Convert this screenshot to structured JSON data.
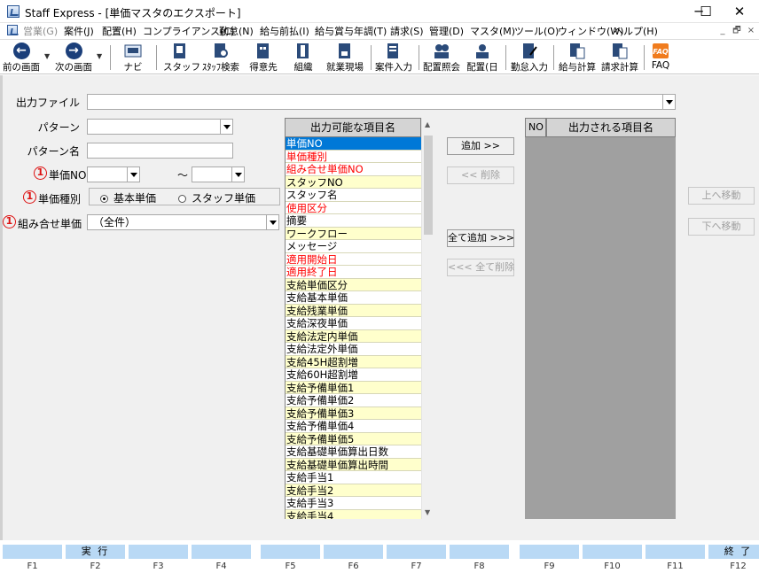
{
  "window": {
    "title": "Staff Express - [単価マスタのエクスポート]",
    "minimize": "─",
    "maximize": "☐",
    "close": "✕"
  },
  "menu": [
    {
      "label": "営業(G)",
      "disabled": true
    },
    {
      "label": "案件(J)"
    },
    {
      "label": "配置(H)"
    },
    {
      "label": "コンプライアンス(C)"
    },
    {
      "label": "勤怠(N)"
    },
    {
      "label": "給与前払(I)"
    },
    {
      "label": "給与賞与年調(T)"
    },
    {
      "label": "請求(S)"
    },
    {
      "label": "管理(D)"
    },
    {
      "label": "マスタ(M)"
    },
    {
      "label": "ツール(O)"
    },
    {
      "label": "ウィンドウ(W)"
    },
    {
      "label": "ヘルプ(H)"
    }
  ],
  "mdi_controls": [
    "_",
    "🗗",
    "×"
  ],
  "toolbar": {
    "prev": "前の画面",
    "next": "次の画面",
    "navi": "ナビ",
    "staff": "スタッフ",
    "staff_search": "ｽﾀｯﾌ検索",
    "client": "得意先",
    "org": "組織",
    "site": "就業現場",
    "case_input": "案件入力",
    "assign_inquiry": "配置照会",
    "assign_day": "配置(日",
    "attendance_input": "勤怠入力",
    "payroll_calc": "給与計算",
    "billing_calc": "請求計算",
    "faq": "FAQ"
  },
  "form": {
    "output_file_label": "出力ファイル",
    "output_file_value": "",
    "pattern_label": "パターン",
    "pattern_value": "",
    "pattern_name_label": "パターン名",
    "pattern_name_value": "",
    "unit_no_label": "単価NO",
    "unit_no_from": "",
    "unit_no_to": "",
    "range_sep": "～",
    "unit_type_label": "単価種別",
    "radio_basic": "基本単価",
    "radio_staff": "スタッフ単価",
    "combo_unit_label": "組み合せ単価",
    "combo_unit_value": "（全件）",
    "marker": "1"
  },
  "available": {
    "header": "出力可能な項目名",
    "items": [
      {
        "label": "単価NO",
        "style": "selected"
      },
      {
        "label": "単価種別",
        "style": "red"
      },
      {
        "label": "組み合せ単価NO",
        "style": "red"
      },
      {
        "label": "スタッフNO",
        "style": "yellow"
      },
      {
        "label": "スタッフ名",
        "style": ""
      },
      {
        "label": "使用区分",
        "style": "red"
      },
      {
        "label": "摘要",
        "style": ""
      },
      {
        "label": "ワークフロー",
        "style": "yellow"
      },
      {
        "label": "メッセージ",
        "style": ""
      },
      {
        "label": "適用開始日",
        "style": "red"
      },
      {
        "label": "適用終了日",
        "style": "red"
      },
      {
        "label": "支給単価区分",
        "style": "yellow"
      },
      {
        "label": "支給基本単価",
        "style": ""
      },
      {
        "label": "支給残業単価",
        "style": "yellow"
      },
      {
        "label": "支給深夜単価",
        "style": ""
      },
      {
        "label": "支給法定内単価",
        "style": "yellow"
      },
      {
        "label": "支給法定外単価",
        "style": ""
      },
      {
        "label": "支給45H超割増",
        "style": "yellow"
      },
      {
        "label": "支給60H超割増",
        "style": ""
      },
      {
        "label": "支給予備単価1",
        "style": "yellow"
      },
      {
        "label": "支給予備単価2",
        "style": ""
      },
      {
        "label": "支給予備単価3",
        "style": "yellow"
      },
      {
        "label": "支給予備単価4",
        "style": ""
      },
      {
        "label": "支給予備単価5",
        "style": "yellow"
      },
      {
        "label": "支給基礎単価算出日数",
        "style": ""
      },
      {
        "label": "支給基礎単価算出時間",
        "style": "yellow"
      },
      {
        "label": "支給手当1",
        "style": ""
      },
      {
        "label": "支給手当2",
        "style": "yellow"
      },
      {
        "label": "支給手当3",
        "style": ""
      },
      {
        "label": "支給手当4",
        "style": "yellow"
      }
    ]
  },
  "buttons": {
    "add": "追加 >>",
    "remove": "<< 削除",
    "add_all": "全て追加 >>>",
    "remove_all": "<<< 全て削除",
    "move_up": "上へ移動",
    "move_down": "下へ移動"
  },
  "output": {
    "header_no": "NO",
    "header_name": "出力される項目名"
  },
  "fkeys": [
    {
      "key": "F1",
      "label": ""
    },
    {
      "key": "F2",
      "label": "実 行"
    },
    {
      "key": "F3",
      "label": ""
    },
    {
      "key": "F4",
      "label": ""
    },
    {
      "key": "F5",
      "label": ""
    },
    {
      "key": "F6",
      "label": ""
    },
    {
      "key": "F7",
      "label": ""
    },
    {
      "key": "F8",
      "label": ""
    },
    {
      "key": "F9",
      "label": ""
    },
    {
      "key": "F10",
      "label": ""
    },
    {
      "key": "F11",
      "label": ""
    },
    {
      "key": "F12",
      "label": "終 了"
    }
  ],
  "colors": {
    "selected": "#0078d7",
    "required_red": "#ff0000",
    "row_yellow": "#ffffcc",
    "fkey_blue": "#b9d9f5"
  }
}
